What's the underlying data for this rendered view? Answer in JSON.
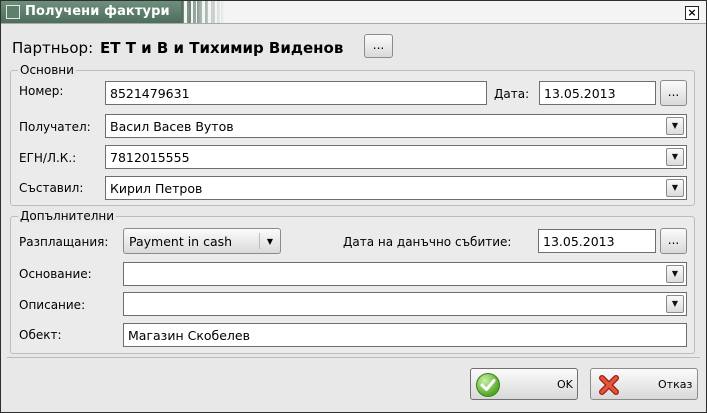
{
  "window": {
    "title": "Получени фактури",
    "close_label": "×"
  },
  "partner": {
    "label": "Партньор:",
    "name": "ЕТ Т и В и Тихимир Виденов",
    "browse_label": "..."
  },
  "basic": {
    "title": "Основни",
    "number_label": "Номер:",
    "number_value": "8521479631",
    "date_label": "Дата:",
    "date_value": "13.05.2013",
    "date_browse": "...",
    "recipient_label": "Получател:",
    "recipient_value": "Васил Васев Вутов",
    "egn_label": "ЕГН/Л.К.:",
    "egn_value": "7812015555",
    "composer_label": "Съставил:",
    "composer_value": "Кирил Петров"
  },
  "additional": {
    "title": "Допълнителни",
    "payment_label": "Разплащания:",
    "payment_value": "Payment in cash",
    "tax_date_label": "Дата на данъчно събитие:",
    "tax_date_value": "13.05.2013",
    "tax_date_browse": "...",
    "basis_label": "Основание:",
    "basis_value": "",
    "description_label": "Описание:",
    "description_value": "",
    "object_label": "Обект:",
    "object_value": "Магазин Скобелев"
  },
  "buttons": {
    "ok_label": "OK",
    "cancel_label": "Отказ"
  },
  "icons": {
    "dropdown": "chevron-down-icon",
    "ok": "check-icon",
    "cancel": "x-icon",
    "window": "window-icon"
  }
}
